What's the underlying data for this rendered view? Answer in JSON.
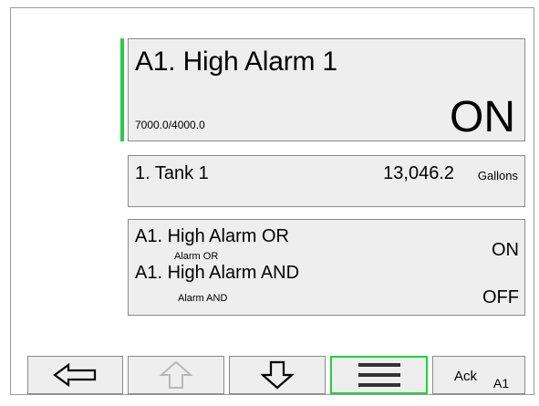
{
  "alarm": {
    "title": "A1. High Alarm 1",
    "setpoints": "7000.0/4000.0",
    "state": "ON",
    "accent_color": "#22d13a"
  },
  "tank": {
    "name": "1. Tank 1",
    "value": "13,046.2",
    "unit": "Gallons"
  },
  "logic": {
    "or_name": "A1. High Alarm OR",
    "or_sub": "Alarm OR",
    "or_state": "ON",
    "and_name": "A1. High Alarm AND",
    "and_sub": "Alarm AND",
    "and_state": "OFF"
  },
  "toolbar": {
    "back_icon": "arrow-left-icon",
    "up_icon": "arrow-up-icon",
    "down_icon": "arrow-down-icon",
    "menu_icon": "menu-icon",
    "ack_label": "Ack",
    "ack_sub": "A1",
    "active_color": "#22d13a"
  }
}
